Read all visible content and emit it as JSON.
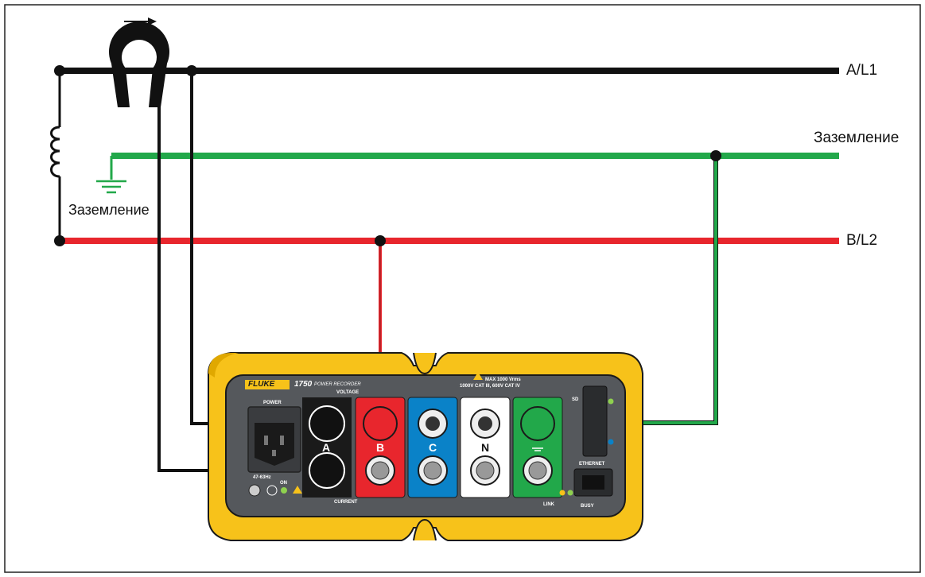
{
  "lines": {
    "line1": "A/L1",
    "ground": "Заземление",
    "line2": "B/L2",
    "ground_symbol_label": "Заземление"
  },
  "device": {
    "brand": "FLUKE",
    "model": "1750",
    "model_desc": "POWER RECORDER",
    "voltage_label": "VOLTAGE",
    "current_label": "CURRENT",
    "power_label": "POWER",
    "freq_label": "47-63Hz",
    "on_label": "ON",
    "max_rating": "MAX 1000 Vrms",
    "cat_rating": "1000V CAT III, 600V CAT IV",
    "channels": [
      "A",
      "B",
      "C",
      "N"
    ],
    "sd_label": "SD",
    "ethernet_label": "ETHERNET",
    "link_label": "LINK",
    "busy_label": "BUSY"
  },
  "colors": {
    "line1": "#111111",
    "ground": "#22a84a",
    "line2": "#e8262d",
    "case": "#f7c21a",
    "panel": "#55585c",
    "channel_a": "#1a1a1a",
    "channel_b": "#e8262d",
    "channel_c": "#0a82c8",
    "channel_n": "#ffffff",
    "channel_gnd": "#22a84a"
  }
}
